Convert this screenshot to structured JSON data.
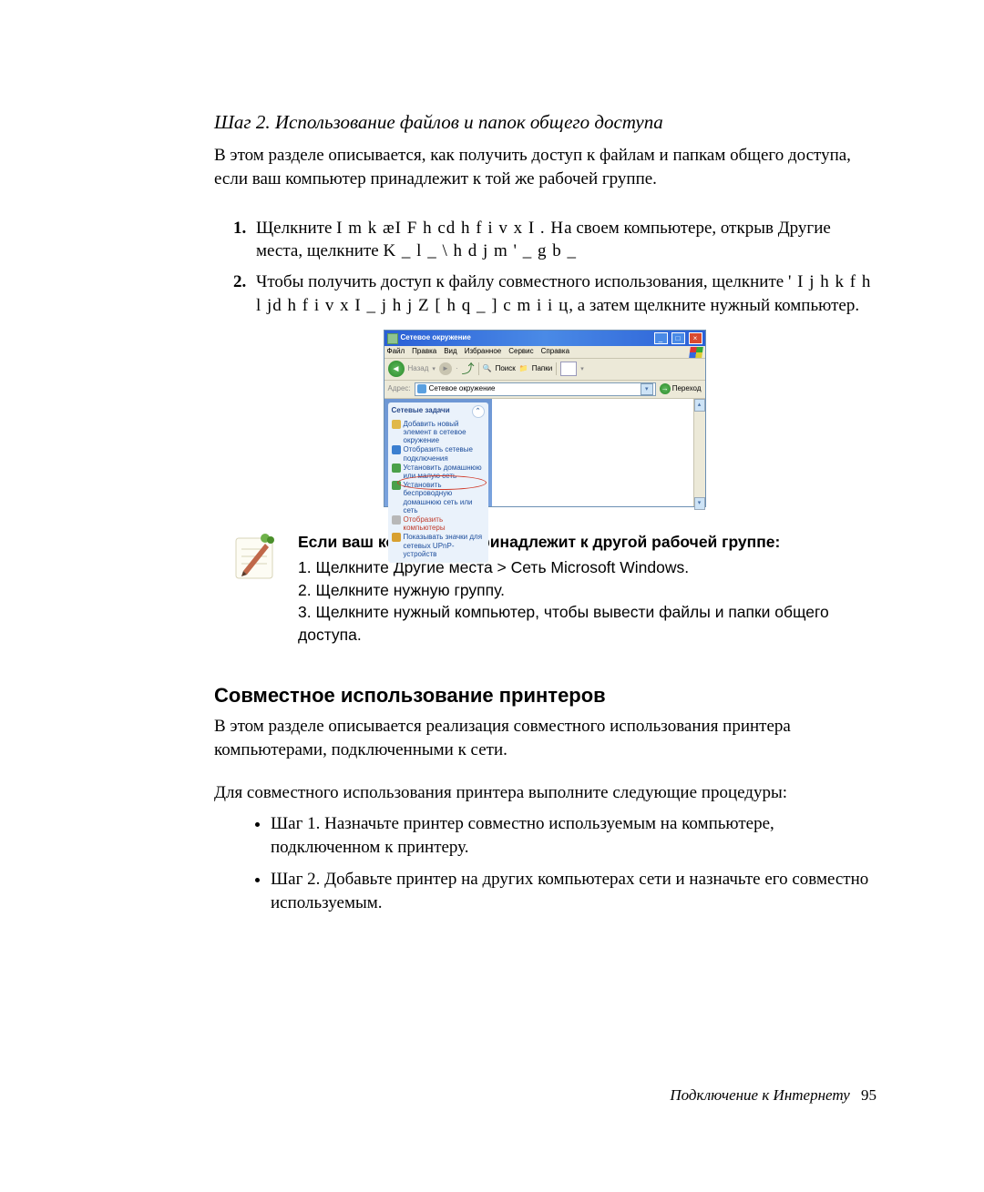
{
  "step_title": "Шаг 2. Использование файлов и папок общего доступа",
  "intro": "В этом разделе описывается, как получить доступ к файлам и папкам общего доступа, если ваш компьютер принадлежит к той же рабочей группе.",
  "list": {
    "item1_a": "Щелкните ",
    "item1_g1": "I m k ӕI F h cd h f i v x I . Н",
    "item1_b": "а своем компьютере, открыв Другие места, щелкните ",
    "item1_g2": "K _ l _ \\ h d j m ' _ g b _",
    "item2_a": "Чтобы получить доступ к файлу совместного использования, щелкните ",
    "item2_g1": "' I j h k f h l jd h f i v x I _ j h j Z [ h q _ ] c m i i ц",
    "item2_b": ", а затем щелкните нужный компьютер."
  },
  "win": {
    "title": "Сетевое окружение",
    "menu": {
      "file": "Файл",
      "edit": "Правка",
      "view": "Вид",
      "fav": "Избранное",
      "tools": "Сервис",
      "help": "Справка"
    },
    "toolbar": {
      "back": "Назад",
      "search": "Поиск",
      "folders": "Папки"
    },
    "address_label": "Адрес:",
    "address_value": "Сетевое окружение",
    "go": "Переход",
    "panel_title": "Сетевые задачи",
    "tasks": [
      "Добавить новый элемент в сетевое окружение",
      "Отобразить сетевые подключения",
      "Установить домашнюю или малую сеть",
      "Установить беспроводную домашнюю сеть или сеть",
      "Отобразить компьютеры",
      "Показывать значки для сетевых UPnP-устройств"
    ]
  },
  "note": {
    "heading": "Если ваш компьютер принадлежит к другой рабочей группе:",
    "l1": "1. Щелкните Другие места > Сеть Microsoft Windows.",
    "l2": "2. Щелкните нужную группу.",
    "l3": "3. Щелкните нужный компьютер, чтобы вывести файлы и папки общего доступа."
  },
  "printers": {
    "heading": "Совместное использование принтеров",
    "p1": "В этом разделе описывается реализация совместного использования принтера компьютерами, подключенными к сети.",
    "p2": "Для совместного использования принтера выполните следующие процедуры:",
    "b1": "Шаг 1. Назначьте принтер совместно используемым на компьютере, подключенном к принтеру.",
    "b2": "Шаг 2. Добавьте принтер на других компьютерах сети и назначьте его совместно используемым."
  },
  "footer": {
    "text": "Подключение к Интернету",
    "page": "95"
  }
}
